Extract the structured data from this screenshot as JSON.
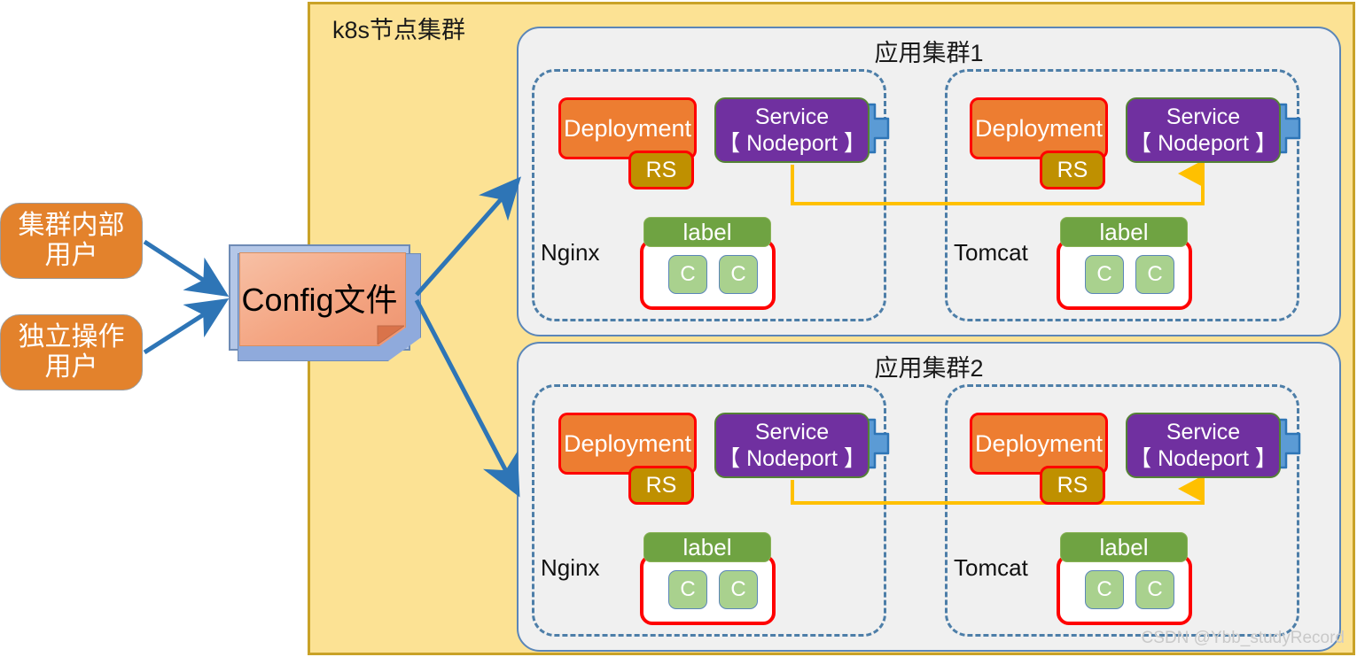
{
  "diagram": {
    "title": "k8s节点集群",
    "watermark": "CSDN @Ybb_studyRecord",
    "colors": {
      "panel_bg": "#FCE294",
      "panel_border": "#C9A227",
      "cluster_bg": "#F0F0F0",
      "cluster_border": "#5B86B8",
      "pod_border": "#4D7EA8",
      "deployment": "#ED7D31",
      "rs": "#BF9000",
      "service": "#7030A0",
      "label": "#6FA342",
      "container": "#A9D18E",
      "user_box": "#E3822C",
      "config_frame": "#B4C7E7",
      "config_page": "#F4A582",
      "blue_arrow": "#2E75B6",
      "yellow_arrow": "#FFC000",
      "highlight_red": "#FF0000",
      "cross_icon": "#5B9BD5"
    }
  },
  "users": [
    {
      "id": "internal",
      "lines": "集群内部\n用户"
    },
    {
      "id": "standalone",
      "lines": "独立操作\n用户"
    }
  ],
  "config": {
    "label": "Config文件"
  },
  "clusters": [
    {
      "title": "应用集群1",
      "pods": [
        {
          "name": "Nginx",
          "deployment": "Deployment",
          "rs": "RS",
          "service_line1": "Service",
          "service_line2": "【 Nodeport 】",
          "label": "label",
          "containers": [
            "C",
            "C"
          ]
        },
        {
          "name": "Tomcat",
          "deployment": "Deployment",
          "rs": "RS",
          "service_line1": "Service",
          "service_line2": "【 Nodeport 】",
          "label": "label",
          "containers": [
            "C",
            "C"
          ]
        }
      ]
    },
    {
      "title": "应用集群2",
      "pods": [
        {
          "name": "Nginx",
          "deployment": "Deployment",
          "rs": "RS",
          "service_line1": "Service",
          "service_line2": "【 Nodeport 】",
          "label": "label",
          "containers": [
            "C",
            "C"
          ]
        },
        {
          "name": "Tomcat",
          "deployment": "Deployment",
          "rs": "RS",
          "service_line1": "Service",
          "service_line2": "【 Nodeport 】",
          "label": "label",
          "containers": [
            "C",
            "C"
          ]
        }
      ]
    }
  ]
}
